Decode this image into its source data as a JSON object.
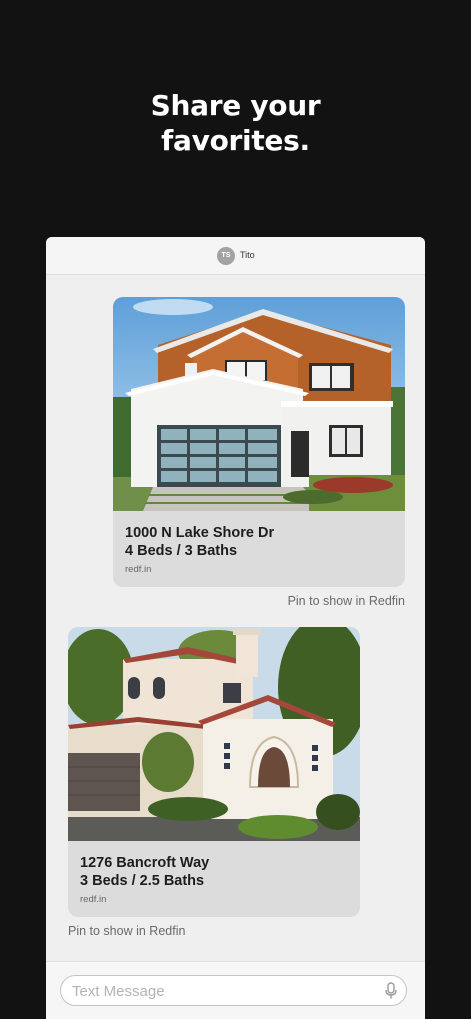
{
  "headline": {
    "line1": "Share your",
    "line2": "favorites."
  },
  "thread": {
    "avatar_initials": "TS",
    "contact_name": "Tito"
  },
  "messages": [
    {
      "address": "1000 N Lake Shore Dr",
      "beds_baths": "4 Beds / 3 Baths",
      "domain": "redf.in",
      "pin_label": "Pin to show in Redfin"
    },
    {
      "address": "1276 Bancroft Way",
      "beds_baths": "3 Beds / 2.5 Baths",
      "domain": "redf.in",
      "pin_label": "Pin to show in Redfin"
    }
  ],
  "composer": {
    "placeholder": "Text Message",
    "icon": "microphone-icon"
  }
}
